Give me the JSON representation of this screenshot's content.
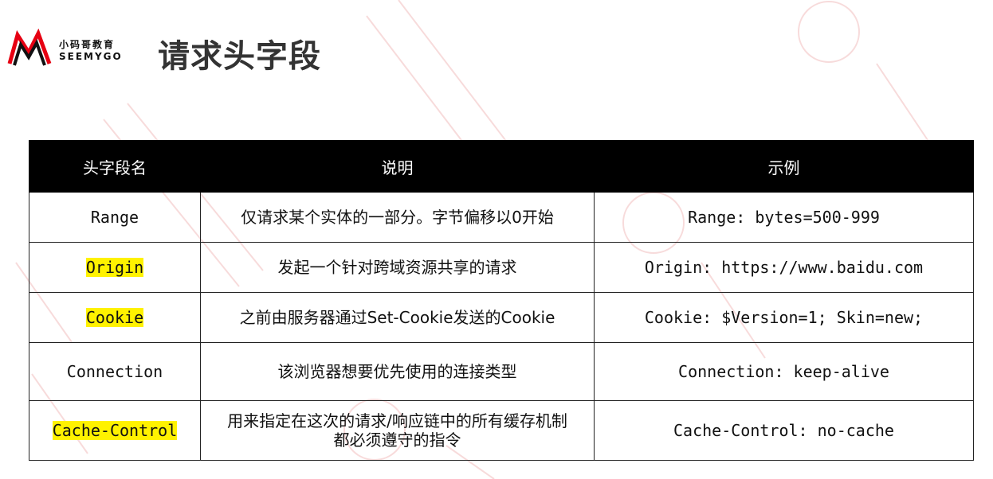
{
  "logo": {
    "brand_cn": "小码哥教育",
    "brand_en": "SEEMYGO",
    "accent_color": "#e60012"
  },
  "page_title": "请求头字段",
  "table": {
    "columns": [
      "头字段名",
      "说明",
      "示例"
    ],
    "rows": [
      {
        "name": "Range",
        "highlight": false,
        "desc": "仅请求某个实体的一部分。字节偏移以0开始",
        "example": "Range: bytes=500-999"
      },
      {
        "name": "Origin",
        "highlight": true,
        "desc": "发起一个针对跨域资源共享的请求",
        "example": "Origin: https://www.baidu.com"
      },
      {
        "name": "Cookie",
        "highlight": true,
        "desc": "之前由服务器通过Set-Cookie发送的Cookie",
        "example": "Cookie: $Version=1; Skin=new;"
      },
      {
        "name": "Connection",
        "highlight": false,
        "desc": "该浏览器想要优先使用的连接类型",
        "example": "Connection: keep-alive"
      },
      {
        "name": "Cache-Control",
        "highlight": true,
        "desc_line1": "用来指定在这次的请求/响应链中的所有缓存机制",
        "desc_line2": "都必须遵守的指令",
        "example": "Cache-Control: no-cache"
      }
    ]
  },
  "colors": {
    "highlight": "#fff200",
    "header_bg": "#000000",
    "watermark": "#f3c6c6"
  }
}
